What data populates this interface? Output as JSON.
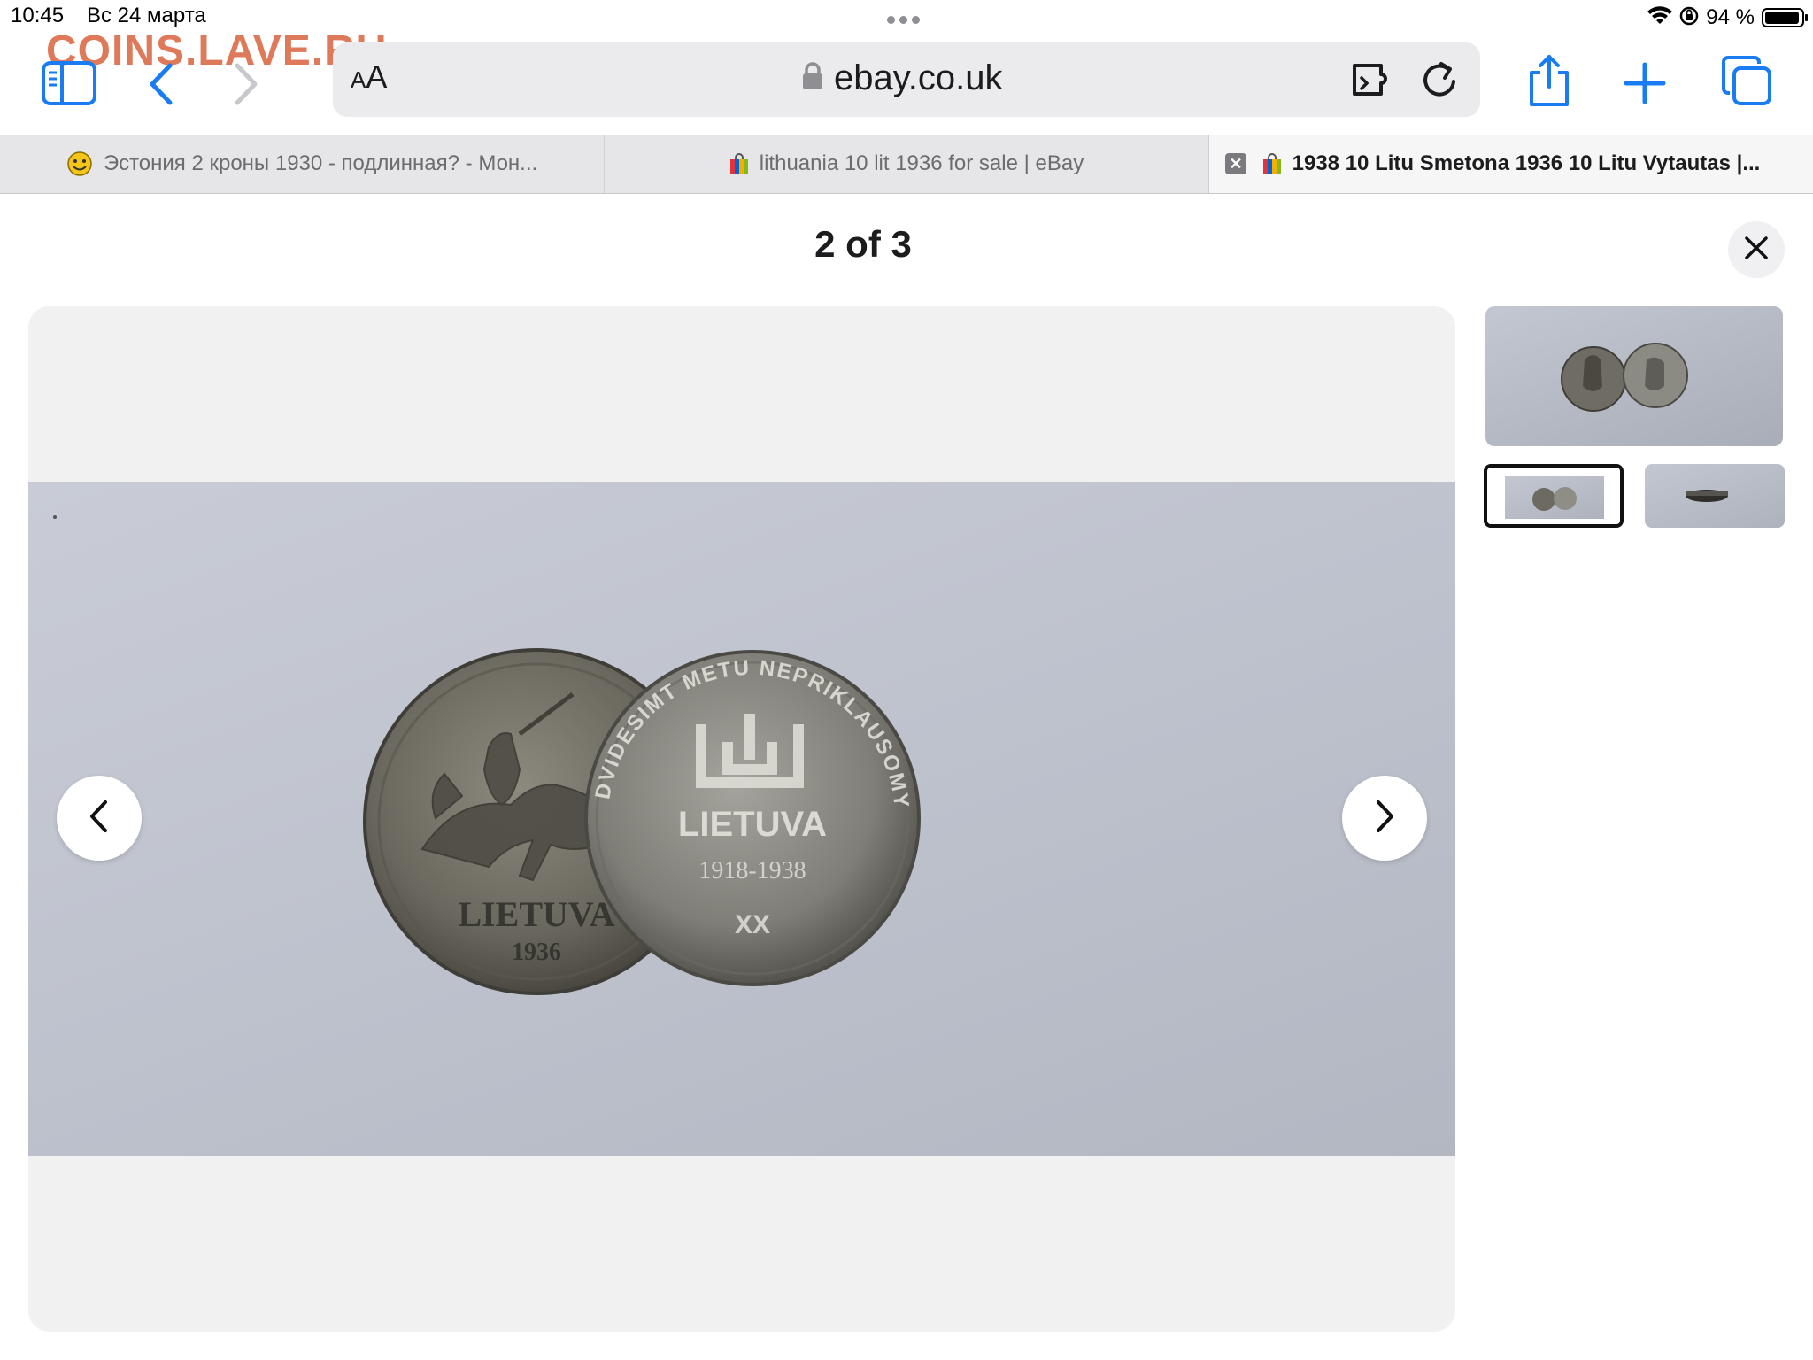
{
  "status_bar": {
    "time": "10:45",
    "date": "Вс 24 марта",
    "battery_text": "94 %",
    "battery_level": 0.94
  },
  "watermark": "COINS.LAVE.RU",
  "toolbar": {
    "text_size_label_small": "A",
    "text_size_label_large": "A",
    "url": "ebay.co.uk",
    "accent_color": "#1a7cf2"
  },
  "tabs": [
    {
      "title": "Эстония 2 кроны 1930 - подлинная? - Мон...",
      "favicon": "smiley-icon",
      "active": false
    },
    {
      "title": "lithuania 10 lit 1936 for sale | eBay",
      "favicon": "ebay-bag-icon",
      "active": false
    },
    {
      "title": "1938 10 Litu Smetona 1936 10 Litu Vytautas |...",
      "favicon": "ebay-bag-icon",
      "active": true
    }
  ],
  "viewer": {
    "counter": "2 of 3",
    "current_index": 2,
    "total": 3
  },
  "coins": {
    "left": {
      "legend": "LIETUVA",
      "year": "1936"
    },
    "right": {
      "top_legend": "DVIDESIMT METU NEPRIKLAUSOMYBES",
      "legend": "LIETUVA",
      "years": "1918-1938",
      "bottom": "XX"
    }
  },
  "thumbnails": [
    {
      "label": "two coins obverse",
      "selected": false
    },
    {
      "label": "two coins small",
      "selected": true
    },
    {
      "label": "coin edge",
      "selected": false
    }
  ]
}
